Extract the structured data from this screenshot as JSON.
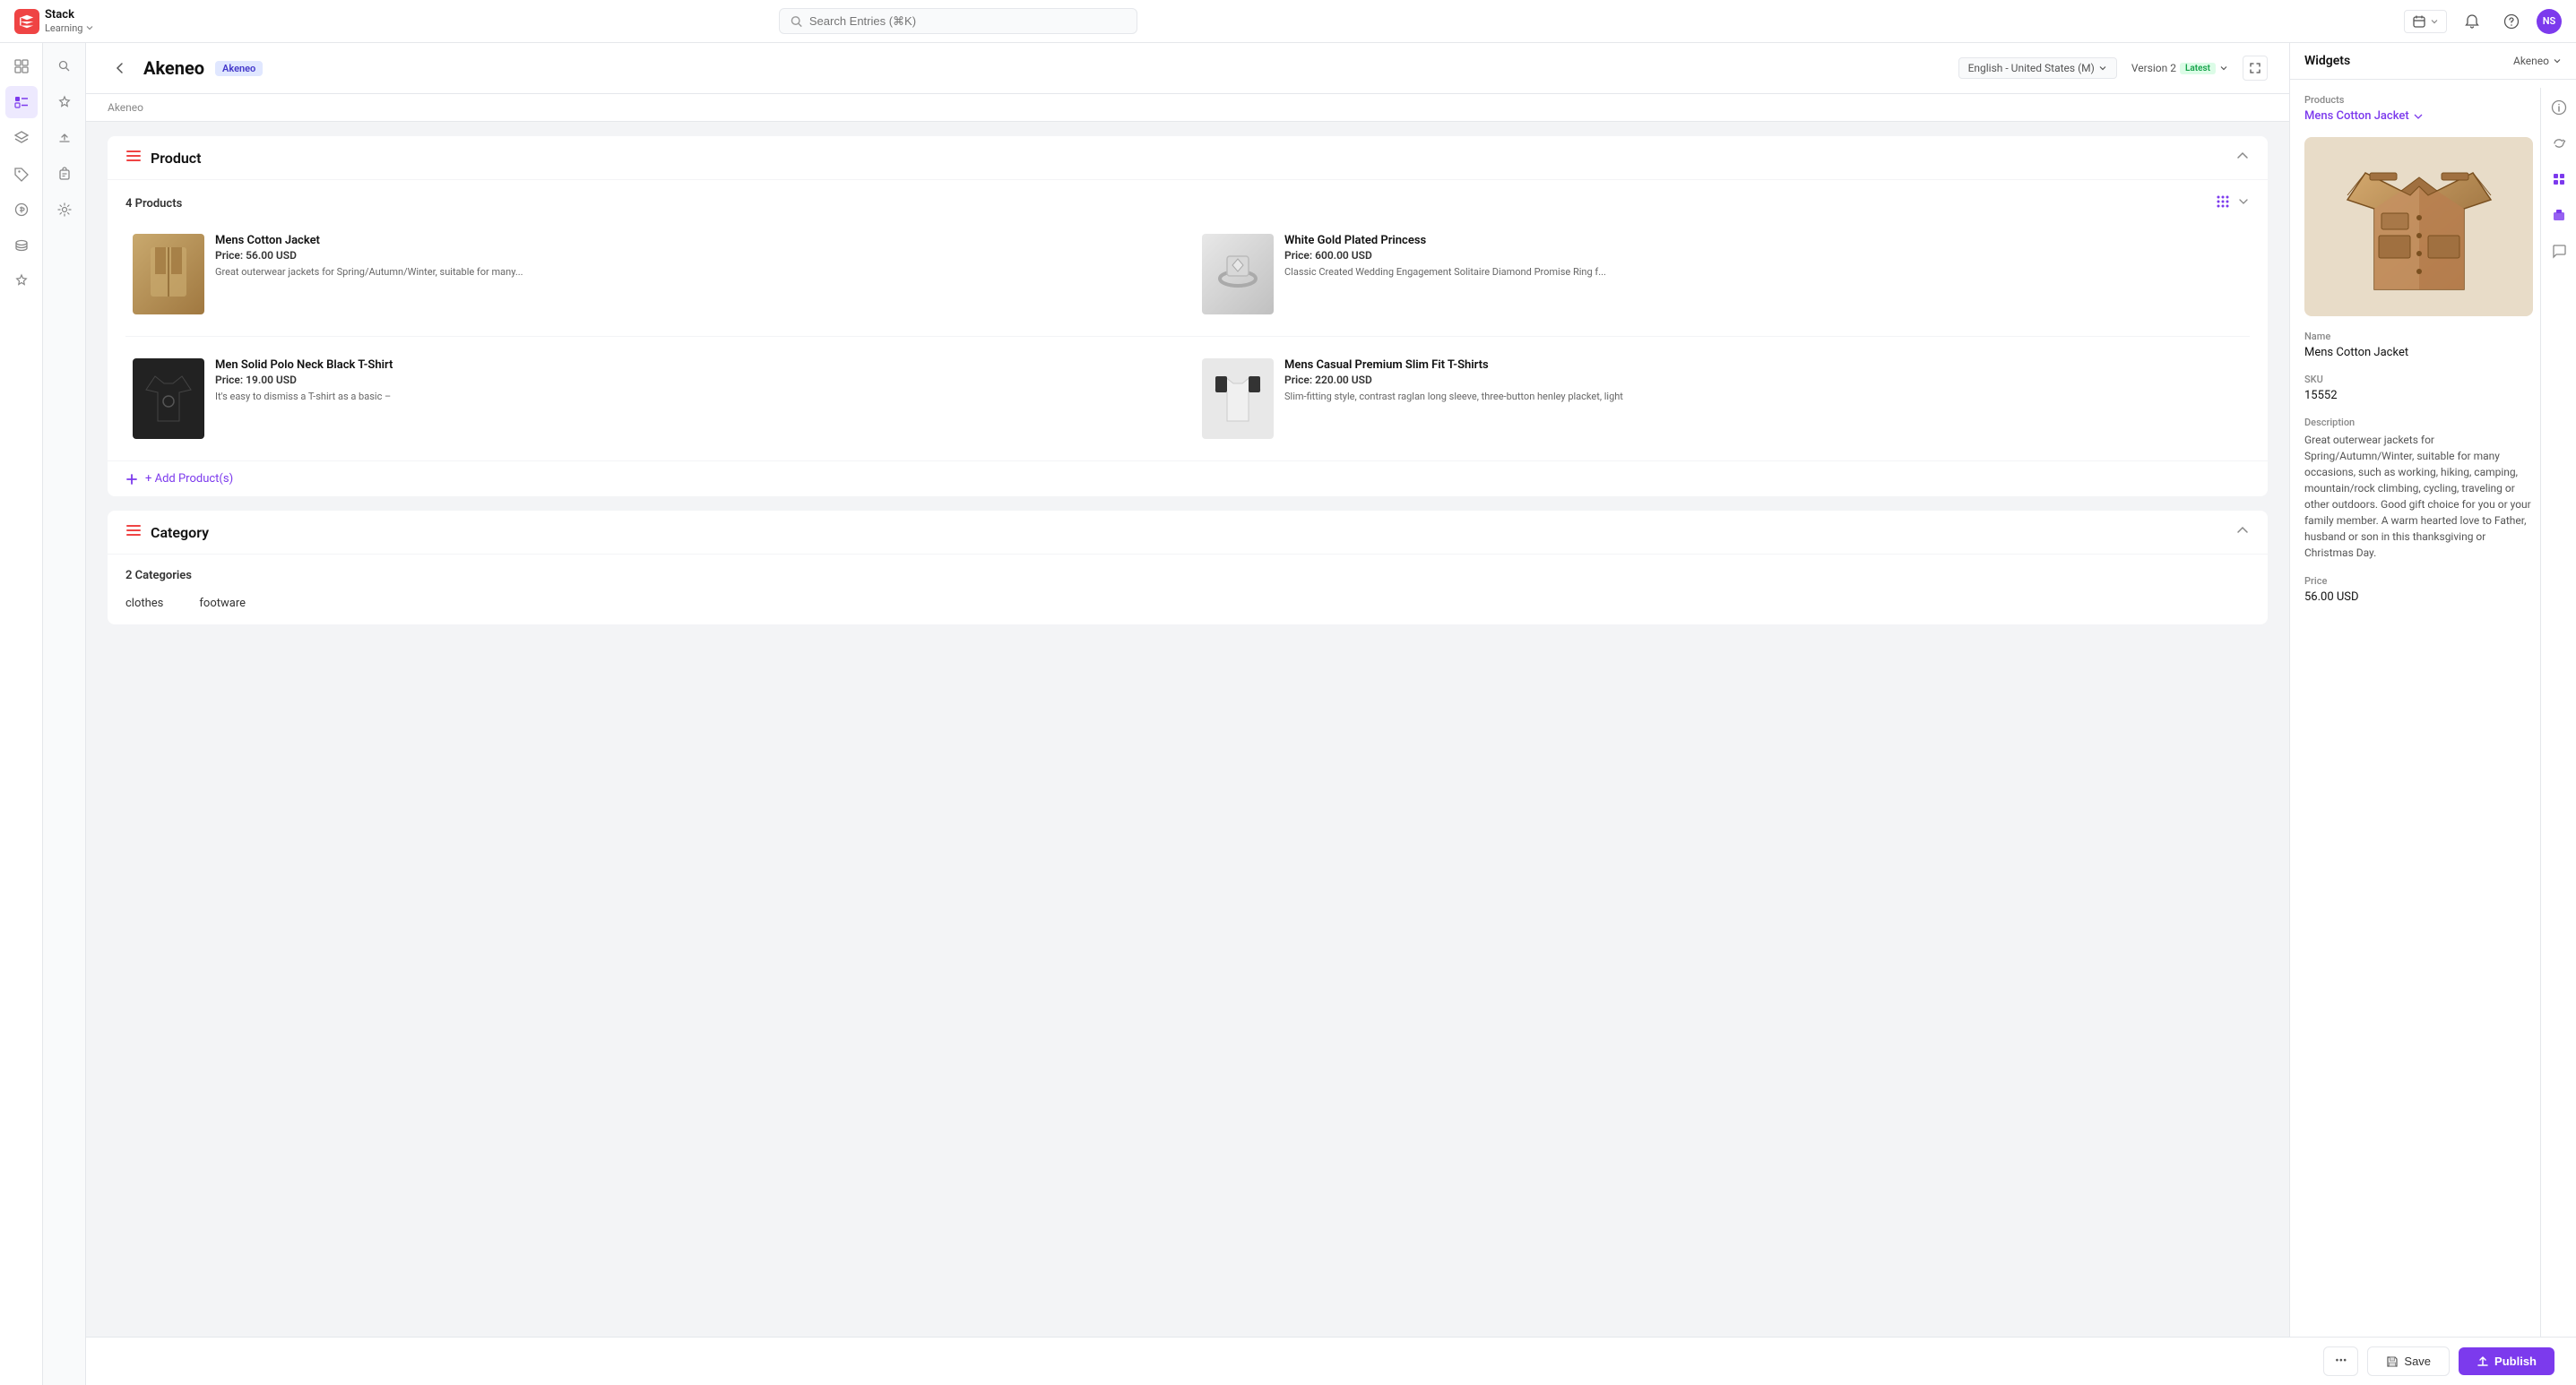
{
  "app": {
    "brand": "Stack",
    "brand_sub": "Learning",
    "avatar_initials": "NS"
  },
  "topbar": {
    "search_placeholder": "Search Entries (⌘K)",
    "calendar_label": "calendar",
    "notifications_label": "notifications",
    "help_label": "help"
  },
  "page": {
    "back_label": "back",
    "title": "Akeneo",
    "badge": "Akeneo",
    "locale": "English - United States (M)",
    "version": "Version 2",
    "version_badge": "Latest",
    "breadcrumb": "Akeneo"
  },
  "sidebar": {
    "icons": [
      "grid",
      "list",
      "layers",
      "tag",
      "coins",
      "coins2",
      "badge"
    ]
  },
  "product_section": {
    "title": "Product",
    "count_label": "4 Products",
    "products": [
      {
        "name": "Mens Cotton Jacket",
        "price": "Price: 56.00 USD",
        "desc": "Great outerwear jackets for Spring/Autumn/Winter, suitable for many...",
        "img_class": "img-jacket"
      },
      {
        "name": "White Gold Plated Princess",
        "price": "Price: 600.00 USD",
        "desc": "Classic Created Wedding Engagement Solitaire Diamond Promise Ring f...",
        "img_class": "img-ring"
      },
      {
        "name": "Men Solid Polo Neck Black T-Shirt",
        "price": "Price: 19.00 USD",
        "desc": "It's easy to dismiss a T-shirt as a basic –",
        "img_class": "img-tshirt-black"
      },
      {
        "name": "Mens Casual Premium Slim Fit T-Shirts",
        "price": "Price: 220.00 USD",
        "desc": "Slim-fitting style, contrast raglan long sleeve, three-button henley placket, light",
        "img_class": "img-tshirt-white"
      }
    ],
    "add_label": "+ Add Product(s)"
  },
  "category_section": {
    "title": "Category",
    "count_label": "2 Categories",
    "categories": [
      "clothes",
      "footware"
    ]
  },
  "right_panel": {
    "title": "Widgets",
    "source": "Akeneo",
    "products_label": "Products",
    "selected_product": "Mens Cotton Jacket",
    "name_label": "Name",
    "name_value": "Mens Cotton Jacket",
    "sku_label": "SKU",
    "sku_value": "15552",
    "description_label": "Description",
    "description_value": "Great outerwear jackets for Spring/Autumn/Winter, suitable for many occasions, such as working, hiking, camping, mountain/rock climbing, cycling, traveling or other outdoors. Good gift choice for you or your family member. A warm hearted love to Father, husband or son in this thanksgiving or Christmas Day.",
    "price_label": "Price",
    "price_value": "56.00 USD"
  },
  "bottom_bar": {
    "dots_label": "•••",
    "save_label": "Save",
    "publish_label": "Publish"
  }
}
